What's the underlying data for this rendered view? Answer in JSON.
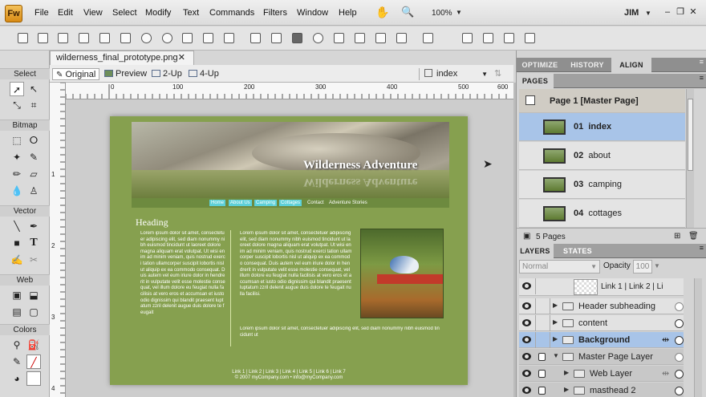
{
  "app": {
    "logo": "Fw",
    "user": "JIM",
    "zoom": "100%"
  },
  "menu": [
    "File",
    "Edit",
    "View",
    "Select",
    "Modify",
    "Text",
    "Commands",
    "Filters",
    "Window",
    "Help"
  ],
  "document": {
    "tab_title": "wilderness_final_prototype.png",
    "close_glyph": "✕",
    "views": [
      "Original",
      "Preview",
      "2-Up",
      "4-Up"
    ],
    "page_select": "index"
  },
  "rulers": {
    "h": [
      "0",
      "100",
      "200",
      "300",
      "400",
      "500",
      "600"
    ],
    "v": [
      "1",
      "2",
      "3",
      "4"
    ]
  },
  "tools": {
    "sections": [
      "Select",
      "Bitmap",
      "Vector",
      "Web",
      "Colors"
    ]
  },
  "mock": {
    "banner_title": "Wilderness Adventure",
    "nav": [
      "Home",
      "About Us",
      "Camping",
      "Cottages",
      "Contact",
      "Adventure Stories"
    ],
    "heading": "Heading",
    "col1": "Lorem ipsum dolor sit amet, consectetuer adipiscing elit, sed diam nonummy nibh euismod tincidunt ut laoreet dolore magna aliquam erat volutpat. Ut wisi enim ad minim veniam, quis nostrud exerci tation ullamcorper suscipit lobortis nisl ut aliquip ex ea commodo consequat. Duis autem vel eum iriure dolor in hendrerit in vulputate velit esse molestie consequat, vel illum dolore eu feugiat nulla facilisis at vero eros et accumsan et iusto odio dignissim qui blandit praesent luptatum zzril delenit augue duis dolore te feugait",
    "col2": "Lorem ipsum dolor sit amet, consectetuer adipiscing elit, sed diam nonummy nibh euismod tincidunt ut laoreet dolore magna aliquam erat volutpat. Ut wisi enim ad minim veniam, quis nostrud exerci tation ullamcorper suscipit lobortis nisl ut aliquip ex ea commodo consequat. Duis autem vel eum iriure dolor in hendrerit in vulputate velit esse molestie consequat, vel illum dolore eu feugiat nulla facilisis at vero eros et accumsan et iusto odio dignissim qui blandit praesent luptatum zzril delenit augue duis dolore te feugait nulla facilisi.",
    "col3": "Lorem ipsum dolor sit amet, consectetuer adipiscing elit, sed diam nonummy nibh euismod tincidunt ut",
    "footer1": "Link 1 | Link 2 | Link 3 | Link 4 | Link 5 | Link 6 | Link 7",
    "footer2": "© 2007 myCompany.com • info@myCompany.com"
  },
  "panels": {
    "top_tabs": [
      "OPTIMIZE",
      "HISTORY",
      "ALIGN"
    ],
    "pages_header": "PAGES",
    "master_page": "Page 1 [Master Page]",
    "pages": [
      {
        "num": "01",
        "name": "index"
      },
      {
        "num": "02",
        "name": "about"
      },
      {
        "num": "03",
        "name": "camping"
      },
      {
        "num": "04",
        "name": "cottages"
      }
    ],
    "pages_count": "5 Pages",
    "layer_tabs": [
      "LAYERS",
      "STATES"
    ],
    "blend_mode": "Normal",
    "opacity_label": "Opacity",
    "opacity_value": "100",
    "layers": [
      {
        "name": "Link 1 | Link 2 | Li"
      },
      {
        "name": "Header subheading"
      },
      {
        "name": "content"
      },
      {
        "name": "Background"
      },
      {
        "name": "Master Page Layer"
      },
      {
        "name": "Web Layer"
      },
      {
        "name": "masthead 2"
      }
    ]
  },
  "colors": {
    "accent_sel": "#a8c4e8",
    "page_green": "#86a04f",
    "nav_cyan": "#5dd0d8"
  }
}
